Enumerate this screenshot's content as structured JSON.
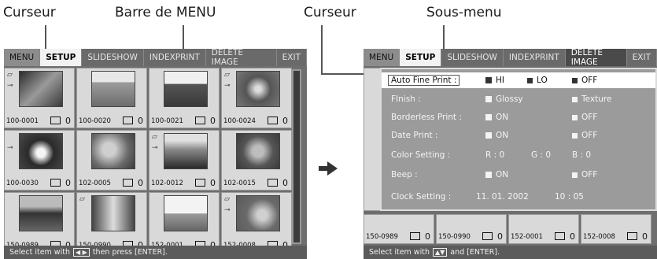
{
  "annotations": {
    "cursor_left": "Curseur",
    "menu_bar": "Barre de MENU",
    "cursor_right": "Curseur",
    "submenu": "Sous-menu"
  },
  "left_screen": {
    "menu_items": [
      "MENU",
      "SETUP",
      "SLIDESHOW",
      "INDEXPRINT",
      "DELETE IMAGE",
      "EXIT"
    ],
    "thumbnails": [
      {
        "label": "100-0001",
        "count": "0"
      },
      {
        "label": "100-0020",
        "count": "0"
      },
      {
        "label": "100-0021",
        "count": "0"
      },
      {
        "label": "100-0024",
        "count": "0"
      },
      {
        "label": "100-0030",
        "count": "0"
      },
      {
        "label": "102-0005",
        "count": "0"
      },
      {
        "label": "102-0012",
        "count": "0"
      },
      {
        "label": "102-0015",
        "count": "0"
      },
      {
        "label": "150-0989",
        "count": "0"
      },
      {
        "label": "150-0990",
        "count": "0"
      },
      {
        "label": "152-0001",
        "count": "0"
      },
      {
        "label": "152-0008",
        "count": "0"
      }
    ],
    "status": {
      "prefix": "Select item with",
      "keys": "◀ ▶",
      "suffix": "then press [ENTER]."
    }
  },
  "right_screen": {
    "menu_items": [
      "MENU",
      "SETUP",
      "SLIDESHOW",
      "INDEXPRINT",
      "DELETE IMAGE",
      "EXIT"
    ],
    "submenu": {
      "auto_fine_print": {
        "label": "Auto Fine Print :",
        "opt1": "HI",
        "opt2": "LO",
        "opt3": "OFF"
      },
      "finish": {
        "label": "FInish :",
        "opt1": "Glossy",
        "opt2": "Texture"
      },
      "borderless": {
        "label": "Borderless Print :",
        "opt1": "ON",
        "opt2": "OFF"
      },
      "date_print": {
        "label": "Date Print :",
        "opt1": "ON",
        "opt2": "OFF"
      },
      "color_setting": {
        "label": "Color Setting :",
        "r": "R :  0",
        "g": "G :  0",
        "b": "B :  0"
      },
      "beep": {
        "label": "Beep :",
        "opt1": "ON",
        "opt2": "OFF"
      },
      "clock": {
        "label": "Clock Setting :",
        "date": "11. 01. 2002",
        "time": "10 : 05"
      }
    },
    "thumb_labels": [
      "150-0989",
      "150-0990",
      "152-0001",
      "152-0008"
    ],
    "thumb_counts": [
      "0",
      "0",
      "0",
      "0"
    ],
    "status": {
      "prefix": "Select item with",
      "keys": "▲▼",
      "suffix": "and [ENTER]."
    }
  },
  "colors": {
    "screen_bg": "#6e6e6e",
    "submenu_bg": "#9b9b9b",
    "highlight": "#ffffff"
  }
}
